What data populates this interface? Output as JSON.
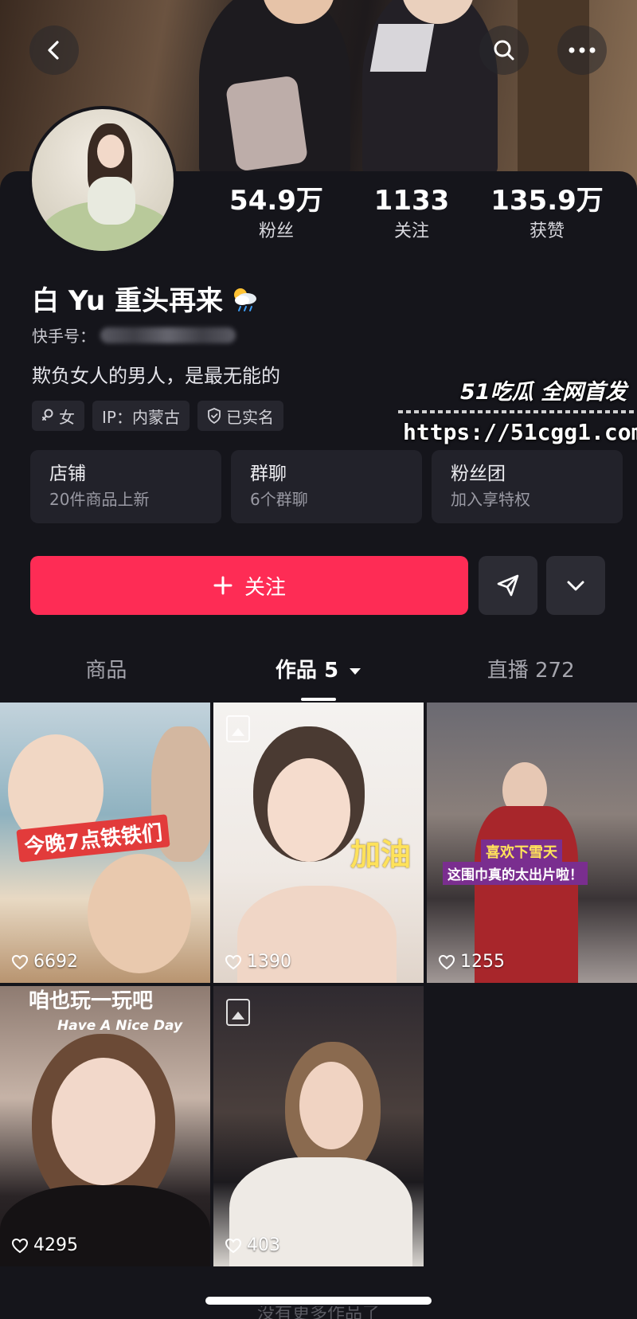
{
  "header": {
    "back_icon": "chevron-left-icon",
    "search_icon": "search-icon",
    "more_icon": "more-horizontal-icon"
  },
  "profile": {
    "name": "白 Yu 重头再来",
    "name_emoji_icon": "weather-sun-rain-icon",
    "kuaishou_id_label": "快手号：",
    "bio": "欺负女人的男人，是最无能的",
    "stats": [
      {
        "value": "54.9万",
        "label": "粉丝"
      },
      {
        "value": "1133",
        "label": "关注"
      },
      {
        "value": "135.9万",
        "label": "获赞"
      }
    ],
    "tags": [
      {
        "icon": "female-icon",
        "label": "女"
      },
      {
        "icon": "",
        "label": "IP：内蒙古"
      },
      {
        "icon": "verified-shield-icon",
        "label": "已实名"
      }
    ]
  },
  "watermark": {
    "title": "51吃瓜 全网首发",
    "url": "https://51cgg1.com"
  },
  "services": [
    {
      "title": "店铺",
      "subtitle": "20件商品上新"
    },
    {
      "title": "群聊",
      "subtitle": "6个群聊"
    },
    {
      "title": "粉丝团",
      "subtitle": "加入享特权"
    }
  ],
  "actions": {
    "follow_label": "关注",
    "follow_icon": "plus-icon",
    "share_icon": "send-icon",
    "dropdown_icon": "chevron-down-icon",
    "accent_color": "#fe2c55"
  },
  "tabs": [
    {
      "label": "商品",
      "active": false
    },
    {
      "label": "作品 5",
      "active": true
    },
    {
      "label": "直播 272",
      "active": false
    }
  ],
  "posts": [
    {
      "likes": "6692",
      "caption": "今晚7点铁铁们",
      "image_badge": false
    },
    {
      "likes": "1390",
      "caption": "加油",
      "image_badge": true
    },
    {
      "likes": "1255",
      "caption": "喜欢下雪天",
      "caption2": "这围巾真的太出片啦！",
      "image_badge": false
    },
    {
      "likes": "4295",
      "caption": "咱也玩一玩吧",
      "caption2": "Have A Nice Day",
      "image_badge": false
    },
    {
      "likes": "403",
      "caption": "",
      "image_badge": true
    }
  ],
  "footer": {
    "no_more_text": "没有更多作品了"
  }
}
